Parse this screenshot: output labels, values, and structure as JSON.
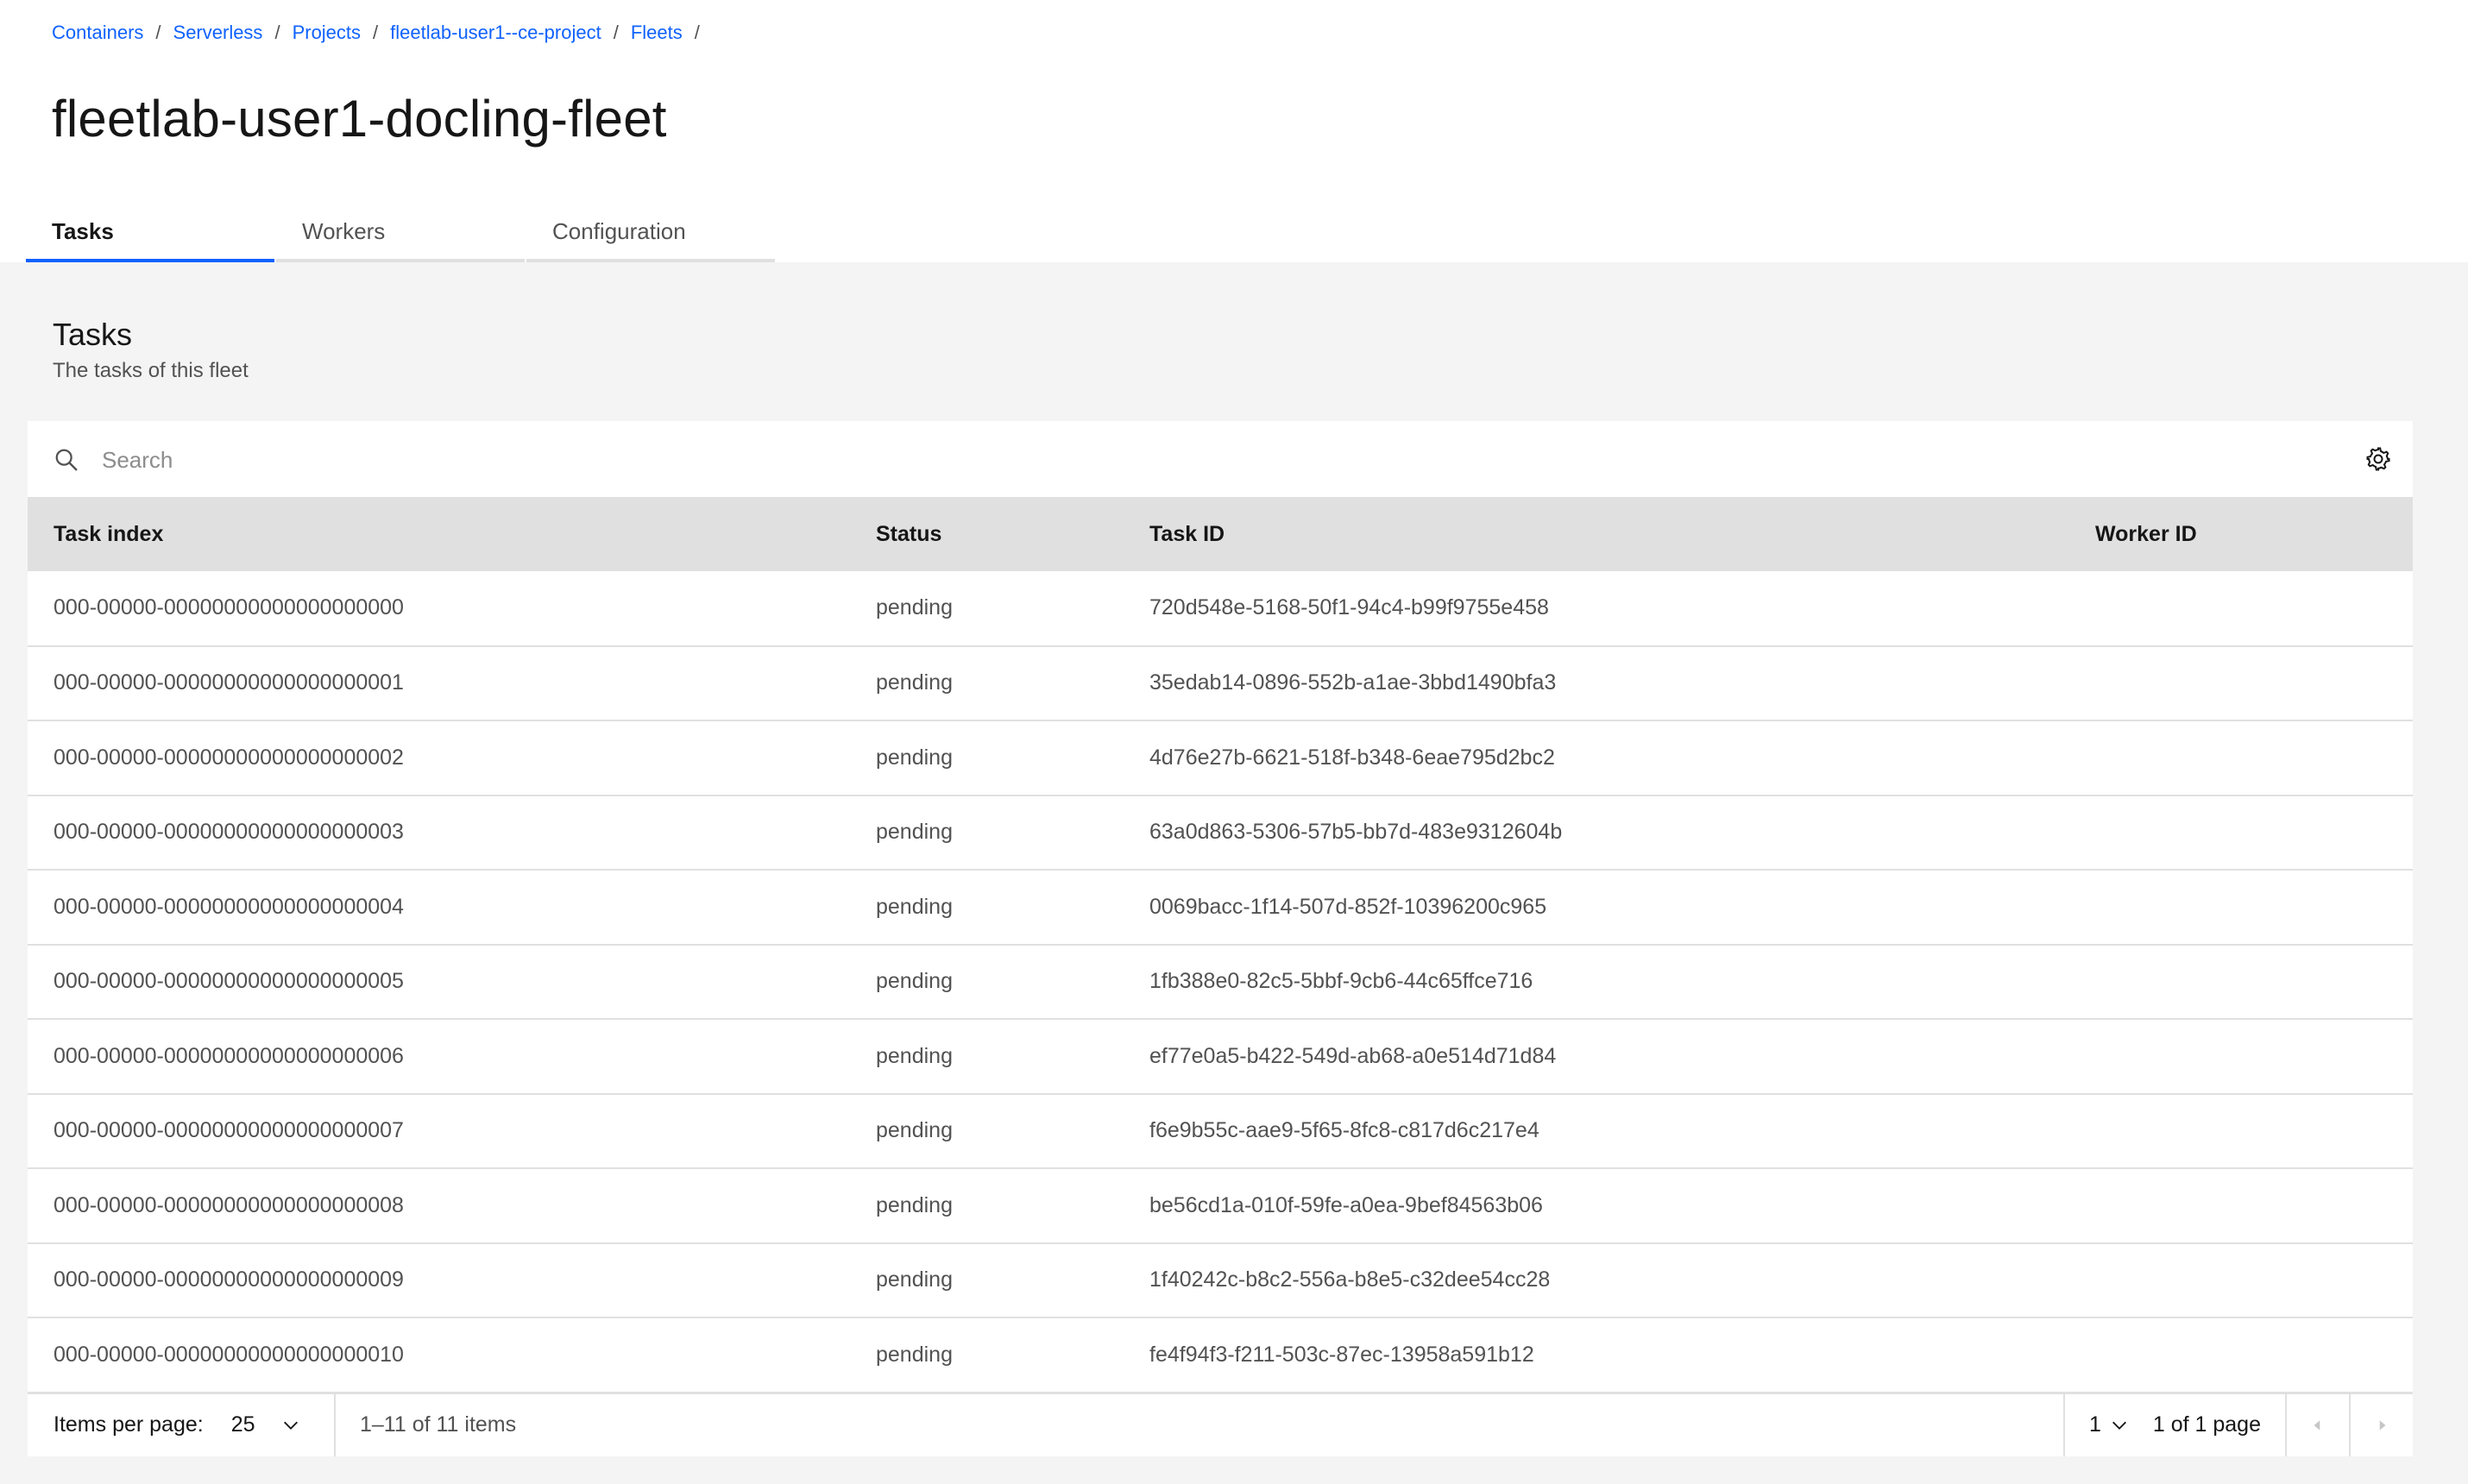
{
  "breadcrumb": [
    {
      "label": "Containers"
    },
    {
      "label": "Serverless"
    },
    {
      "label": "Projects"
    },
    {
      "label": "fleetlab-user1--ce-project"
    },
    {
      "label": "Fleets"
    }
  ],
  "breadcrumb_separator": "/",
  "page_title": "fleetlab-user1-docling-fleet",
  "tabs": [
    {
      "label": "Tasks",
      "active": true
    },
    {
      "label": "Workers",
      "active": false
    },
    {
      "label": "Configuration",
      "active": false
    }
  ],
  "section": {
    "title": "Tasks",
    "description": "The tasks of this fleet"
  },
  "search": {
    "placeholder": "Search",
    "value": ""
  },
  "icons": {
    "search": "search-icon",
    "settings": "gear-icon",
    "dropdown": "chevron-down-icon",
    "prev": "caret-left-icon",
    "next": "caret-right-icon"
  },
  "table": {
    "columns": [
      "Task index",
      "Status",
      "Task ID",
      "Worker ID"
    ],
    "rows": [
      [
        "000-00000-00000000000000000000",
        "pending",
        "720d548e-5168-50f1-94c4-b99f9755e458",
        ""
      ],
      [
        "000-00000-00000000000000000001",
        "pending",
        "35edab14-0896-552b-a1ae-3bbd1490bfa3",
        ""
      ],
      [
        "000-00000-00000000000000000002",
        "pending",
        "4d76e27b-6621-518f-b348-6eae795d2bc2",
        ""
      ],
      [
        "000-00000-00000000000000000003",
        "pending",
        "63a0d863-5306-57b5-bb7d-483e9312604b",
        ""
      ],
      [
        "000-00000-00000000000000000004",
        "pending",
        "0069bacc-1f14-507d-852f-10396200c965",
        ""
      ],
      [
        "000-00000-00000000000000000005",
        "pending",
        "1fb388e0-82c5-5bbf-9cb6-44c65ffce716",
        ""
      ],
      [
        "000-00000-00000000000000000006",
        "pending",
        "ef77e0a5-b422-549d-ab68-a0e514d71d84",
        ""
      ],
      [
        "000-00000-00000000000000000007",
        "pending",
        "f6e9b55c-aae9-5f65-8fc8-c817d6c217e4",
        ""
      ],
      [
        "000-00000-00000000000000000008",
        "pending",
        "be56cd1a-010f-59fe-a0ea-9bef84563b06",
        ""
      ],
      [
        "000-00000-00000000000000000009",
        "pending",
        "1f40242c-b8c2-556a-b8e5-c32dee54cc28",
        ""
      ],
      [
        "000-00000-00000000000000000010",
        "pending",
        "fe4f94f3-f211-503c-87ec-13958a591b12",
        ""
      ]
    ]
  },
  "pagination": {
    "items_per_page_label": "Items per page:",
    "items_per_page_value": "25",
    "range_text": "1–11 of 11 items",
    "page_value": "1",
    "page_of_text": "1 of 1 page"
  },
  "colors": {
    "link": "#0f62fe",
    "active_tab_underline": "#0f62fe",
    "background_gray": "#f4f4f4",
    "header_row": "#e0e0e0"
  }
}
